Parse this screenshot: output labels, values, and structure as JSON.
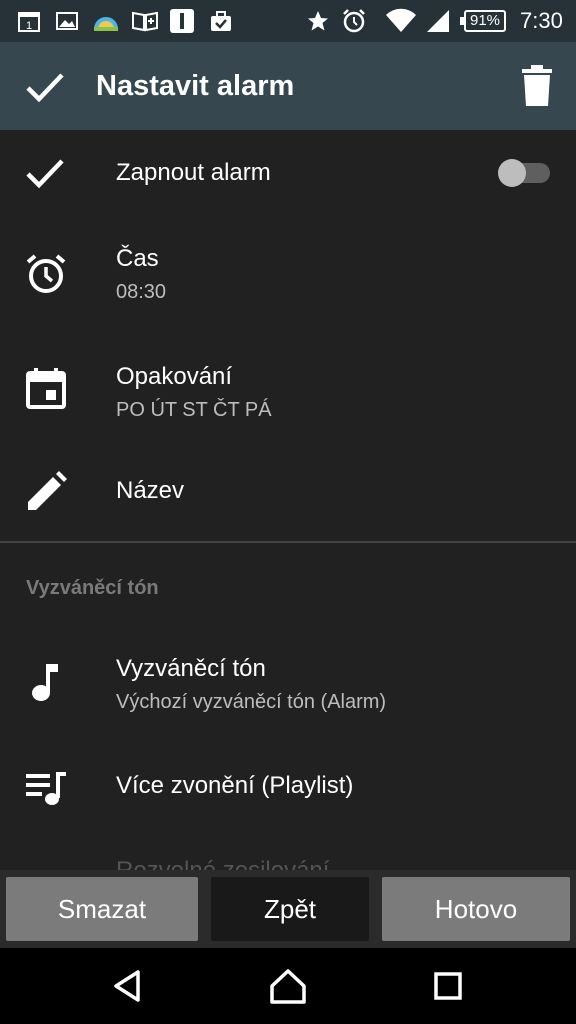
{
  "status_bar": {
    "calendar_day": "1",
    "battery_level": "91%",
    "time": "7:30",
    "icons": [
      "calendar-icon",
      "gallery-icon",
      "weather-icon",
      "book-icon",
      "flashlight-icon",
      "briefcase-icon",
      "star-icon",
      "alarm-icon",
      "wifi-icon",
      "signal-icon",
      "battery-icon"
    ]
  },
  "toolbar": {
    "title": "Nastavit alarm"
  },
  "settings": {
    "enable": {
      "label": "Zapnout alarm",
      "enabled": false
    },
    "time": {
      "label": "Čas",
      "value": "08:30"
    },
    "repeat": {
      "label": "Opakování",
      "value": "PO ÚT ST ČT PÁ"
    },
    "name": {
      "label": "Název"
    },
    "ringtone_section": {
      "header": "Vyzváněcí tón",
      "ringtone": {
        "label": "Vyzváněcí tón",
        "value": "Výchozí vyzváněcí tón (Alarm)"
      },
      "playlist": {
        "label": "Více zvonění (Playlist)"
      },
      "next_partial": {
        "label": "Rozvolné zesilování"
      }
    }
  },
  "buttons": {
    "delete": "Smazat",
    "back": "Zpět",
    "done": "Hotovo"
  },
  "colors": {
    "background": "#212121",
    "toolbar": "#37474f",
    "status_bar": "#263238",
    "button_grey": "#7b7b7b",
    "secondary_text": "#bdbdbd"
  }
}
